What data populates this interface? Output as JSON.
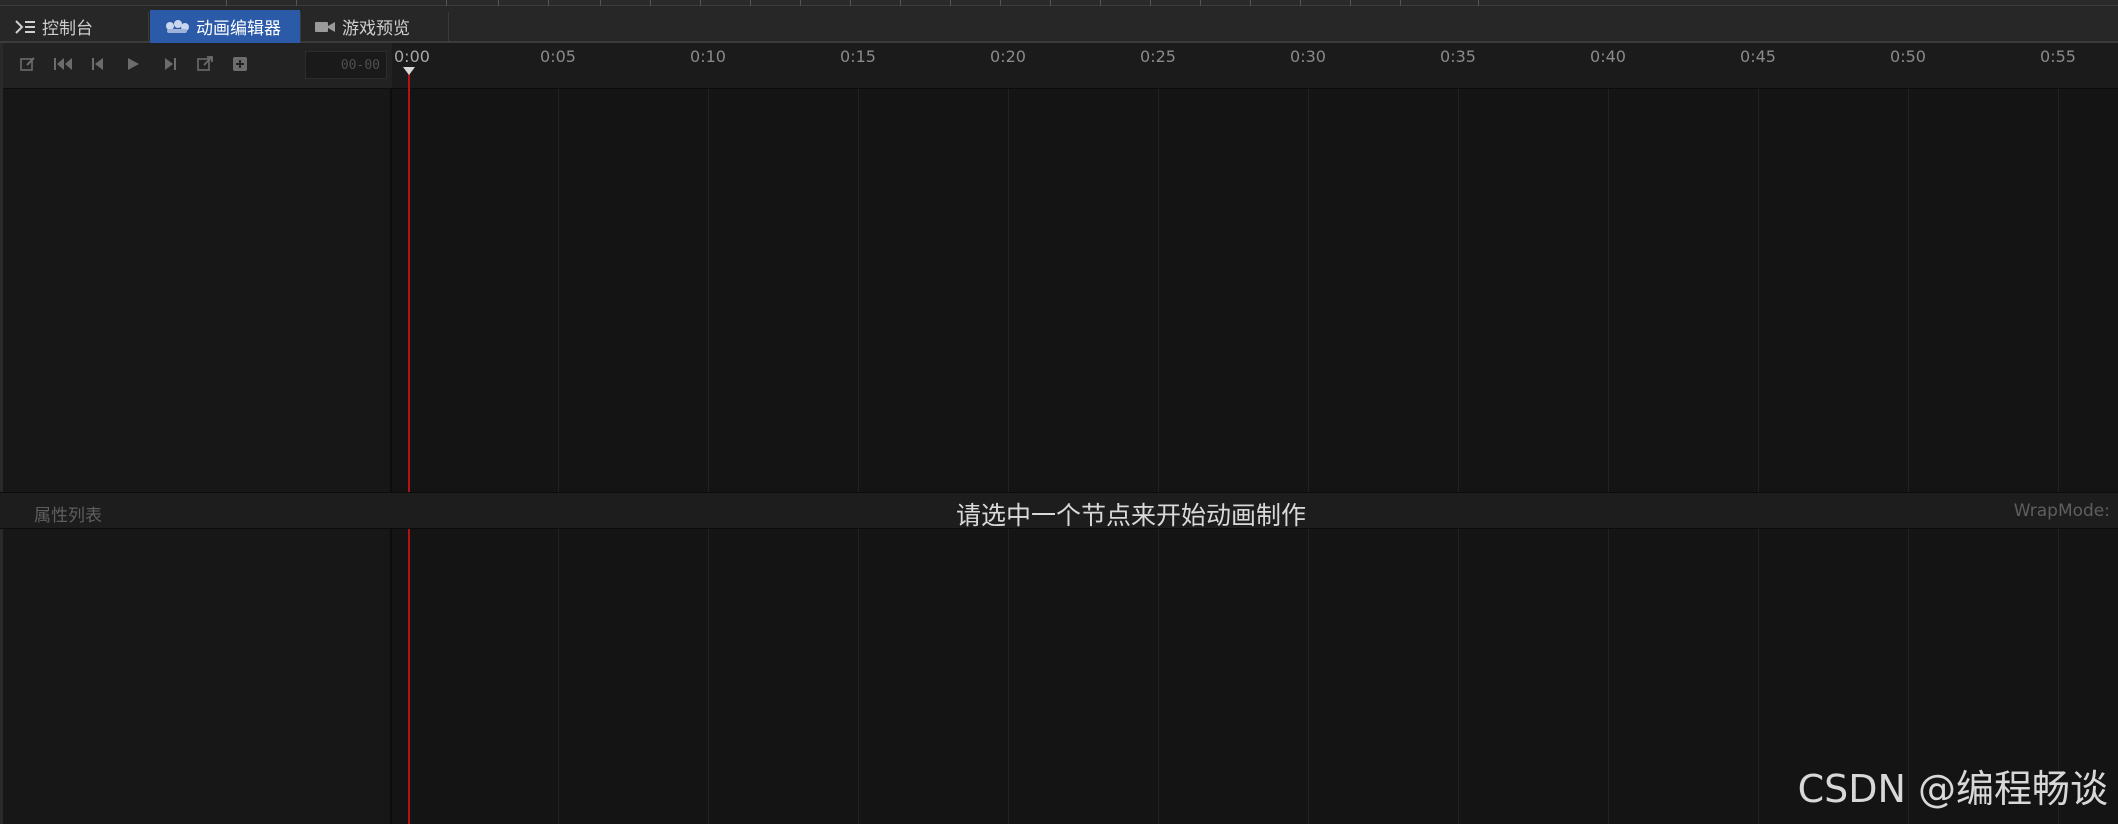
{
  "tabs": [
    {
      "id": "console",
      "label": "控制台",
      "icon": "console-icon",
      "active": false
    },
    {
      "id": "animation-editor",
      "label": "动画编辑器",
      "icon": "animation-icon",
      "active": true
    },
    {
      "id": "game-preview",
      "label": "游戏预览",
      "icon": "camera-icon",
      "active": false
    }
  ],
  "toolbar": {
    "buttons": [
      {
        "name": "edit-icon",
        "title": "edit"
      },
      {
        "name": "jump-to-start-icon",
        "title": "jump to start"
      },
      {
        "name": "previous-frame-icon",
        "title": "previous frame"
      },
      {
        "name": "play-icon",
        "title": "play"
      },
      {
        "name": "next-frame-icon",
        "title": "next frame"
      },
      {
        "name": "open-external-icon",
        "title": "open"
      },
      {
        "name": "add-event-icon",
        "title": "add"
      }
    ],
    "time_value": "00-00"
  },
  "ruler": {
    "labels": [
      "0:00",
      "0:05",
      "0:10",
      "0:15",
      "0:20",
      "0:25",
      "0:30",
      "0:35",
      "0:40",
      "0:45",
      "0:50",
      "0:55"
    ]
  },
  "property_list_label": "属性列表",
  "hint_text": "请选中一个节点来开始动画制作",
  "wrapmode_label": "WrapMode:",
  "watermark": "CSDN @编程畅谈",
  "colors": {
    "accent": "#2b5aa8",
    "playhead": "#b01414",
    "background": "#141414"
  }
}
